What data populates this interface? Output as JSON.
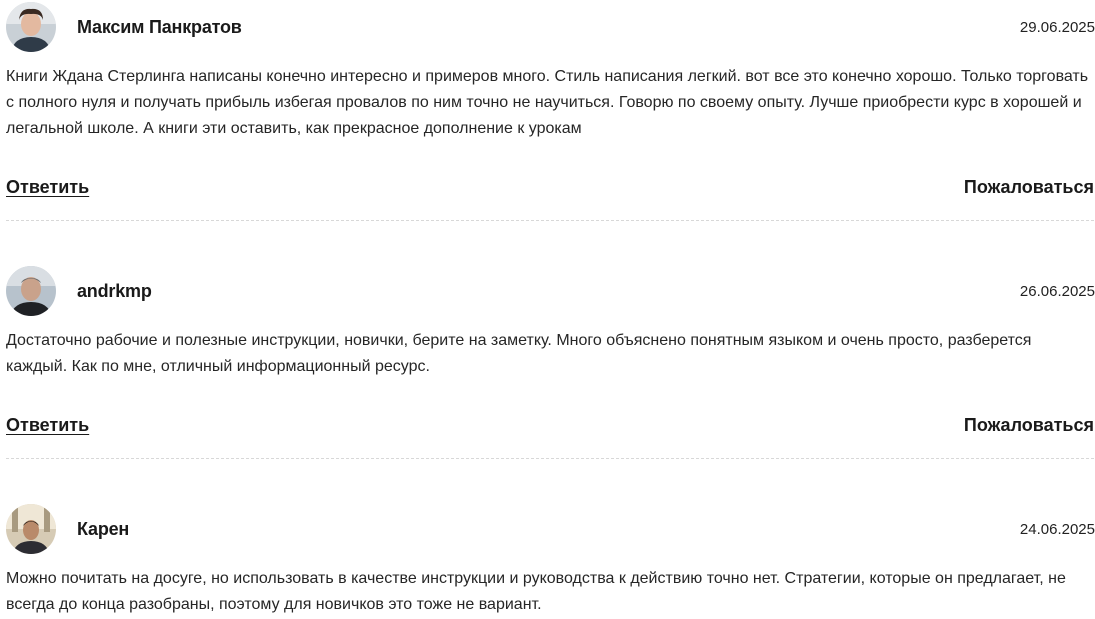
{
  "comments": [
    {
      "author": "Максим Панкратов",
      "date": "29.06.2025",
      "text": "Книги Ждана Стерлинга написаны конечно интересно и примеров много. Стиль написания легкий. вот все это конечно хорошо. Только торговать с полного нуля и получать прибыль избегая провалов по ним точно не научиться. Говорю по своему опыту. Лучше приобрести курс в хорошей и легальной школе. А книги эти оставить, как прекрасное дополнение к урокам",
      "reply_label": "Ответить",
      "report_label": "Пожаловаться"
    },
    {
      "author": "andrkmp",
      "date": "26.06.2025",
      "text": "Достаточно рабочие и полезные инструкции, новички, берите на заметку. Много объяснено понятным языком и очень просто, разберется каждый. Как по мне, отличный информационный ресурс.",
      "reply_label": "Ответить",
      "report_label": "Пожаловаться"
    },
    {
      "author": "Карен",
      "date": "24.06.2025",
      "text": "Можно почитать на досуге, но использовать в качестве инструкции и руководства к действию точно нет. Стратегии, которые он предлагает, не всегда до конца разобраны, поэтому для новичков это тоже не вариант."
    }
  ],
  "icons": {
    "avatar": "avatar-photo-icon"
  }
}
